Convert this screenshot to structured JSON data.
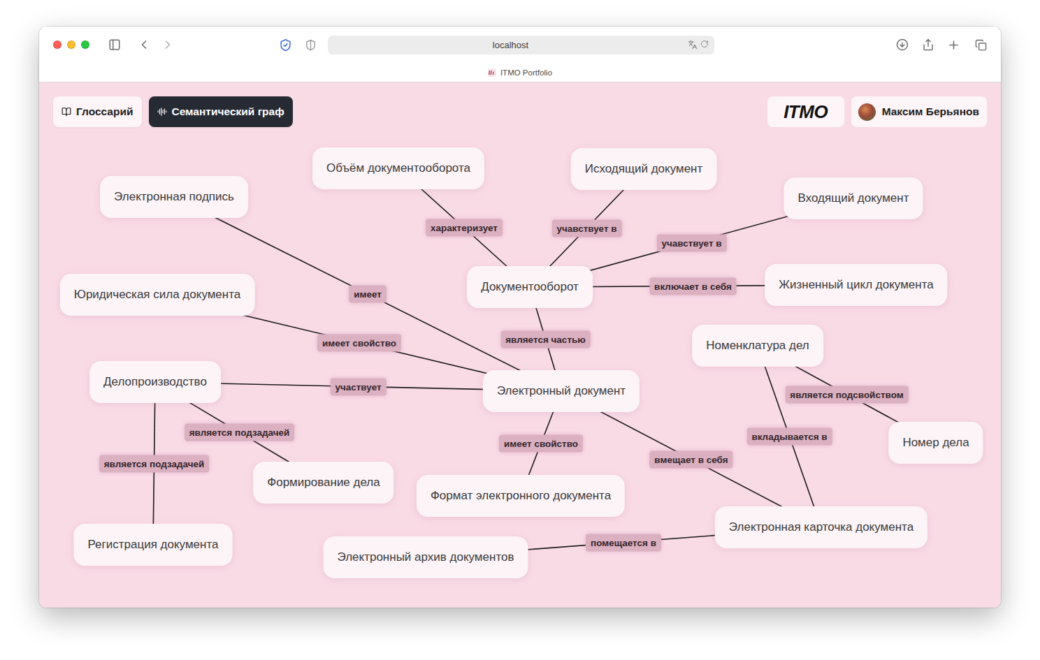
{
  "browser": {
    "address": "localhost",
    "tab": {
      "title": "ITMO Portfolio"
    }
  },
  "nav": [
    {
      "label": "Глоссарий",
      "selected": false
    },
    {
      "label": "Семантический граф",
      "selected": true
    }
  ],
  "logo": "ITMO",
  "user": {
    "name": "Максим Берьянов"
  },
  "graph": {
    "nodes": [
      "Электронная подпись",
      "Объём документооборота",
      "Исходящий документ",
      "Входящий документ",
      "Юридическая сила документа",
      "Документооборот",
      "Жизненный цикл документа",
      "Номенклатура дел",
      "Делопроизводство",
      "Электронный документ",
      "Номер дела",
      "Формирование дела",
      "Формат электронного документа",
      "Регистрация документа",
      "Электронная карточка документа",
      "Электронный архив документов"
    ],
    "edges": [
      {
        "from": "Электронная подпись",
        "to": "Электронный документ",
        "label": "имеет"
      },
      {
        "from": "Объём документооборота",
        "to": "Документооборот",
        "label": "характеризует"
      },
      {
        "from": "Исходящий документ",
        "to": "Документооборот",
        "label": "учавствует в"
      },
      {
        "from": "Входящий документ",
        "to": "Документооборот",
        "label": "учавствует в"
      },
      {
        "from": "Документооборот",
        "to": "Жизненный цикл документа",
        "label": "включает в себя"
      },
      {
        "from": "Юридическая сила документа",
        "to": "Электронный документ",
        "label": "имеет свойство"
      },
      {
        "from": "Документооборот",
        "to": "Электронный документ",
        "label": "является частью"
      },
      {
        "from": "Делопроизводство",
        "to": "Электронный документ",
        "label": "участвует"
      },
      {
        "from": "Делопроизводство",
        "to": "Формирование дела",
        "label": "является подзадачей"
      },
      {
        "from": "Делопроизводство",
        "to": "Регистрация документа",
        "label": "является подзадачей"
      },
      {
        "from": "Электронный документ",
        "to": "Формат электронного документа",
        "label": "имеет свойство"
      },
      {
        "from": "Электронный документ",
        "to": "Электронная карточка документа",
        "label": "вмещает в себя"
      },
      {
        "from": "Номенклатура дел",
        "to": "Номер дела",
        "label": "является подсвойством"
      },
      {
        "from": "Номенклатура дел",
        "to": "Электронная карточка документа",
        "label": "вкладывается в"
      },
      {
        "from": "Электронный архив документов",
        "to": "Электронная карточка документа",
        "label": "помещается в"
      }
    ]
  }
}
